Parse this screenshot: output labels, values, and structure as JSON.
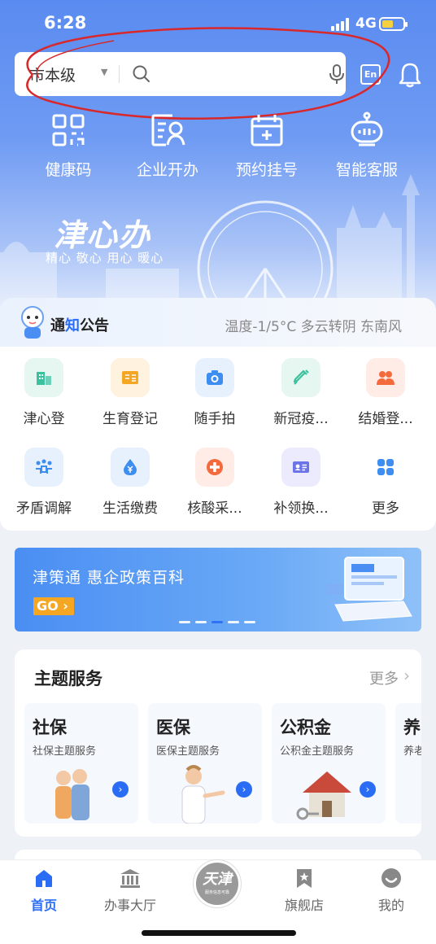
{
  "status_bar": {
    "time": "6:28",
    "network": "4G"
  },
  "search": {
    "region": "市本级",
    "placeholder": ""
  },
  "header_buttons": {
    "lang_label": "En"
  },
  "quick_actions": [
    {
      "label": "健康码",
      "icon": "qr-code-icon"
    },
    {
      "label": "企业开办",
      "icon": "business-card-icon"
    },
    {
      "label": "预约挂号",
      "icon": "medical-appointment-icon"
    },
    {
      "label": "智能客服",
      "icon": "robot-icon"
    }
  ],
  "brand": {
    "logo_text": "津心办",
    "slogan": "精心 敬心 用心 暖心"
  },
  "notice": {
    "title_a": "通",
    "title_b": "知",
    "title_c": "公告",
    "weather": "温度-1/5°C 多云转阴 东南风"
  },
  "services": [
    {
      "label": "津心登",
      "icon": "building-icon",
      "bg": "#e6f6f1",
      "fg": "#3ac19d"
    },
    {
      "label": "生育登记",
      "icon": "certificate-icon",
      "bg": "#fff2df",
      "fg": "#f5a623"
    },
    {
      "label": "随手拍",
      "icon": "camera-icon",
      "bg": "#e6f1fd",
      "fg": "#3d8ef0"
    },
    {
      "label": "新冠疫...",
      "icon": "syringe-icon",
      "bg": "#e6f6f1",
      "fg": "#3ac19d"
    },
    {
      "label": "结婚登...",
      "icon": "couple-icon",
      "bg": "#ffece6",
      "fg": "#f36b3c"
    },
    {
      "label": "矛盾调解",
      "icon": "mediation-icon",
      "bg": "#e6f1fd",
      "fg": "#3d8ef0"
    },
    {
      "label": "生活缴费",
      "icon": "payment-icon",
      "bg": "#e6f1fd",
      "fg": "#3d8ef0"
    },
    {
      "label": "核酸采...",
      "icon": "medical-cross-icon",
      "bg": "#ffece6",
      "fg": "#f36b3c"
    },
    {
      "label": "补领换...",
      "icon": "id-card-icon",
      "bg": "#ecebfd",
      "fg": "#6b74e8"
    },
    {
      "label": "更多",
      "icon": "more-grid-icon",
      "bg": "#ffffff",
      "fg": "#3d8ef0"
    }
  ],
  "banner": {
    "title": "津策通 惠企政策百科",
    "cta": "GO"
  },
  "themes": {
    "title": "主题服务",
    "more": "更多",
    "cards": [
      {
        "title": "社保",
        "subtitle": "社保主题服务"
      },
      {
        "title": "医保",
        "subtitle": "医保主题服务"
      },
      {
        "title": "公积金",
        "subtitle": "公积金主题服务"
      },
      {
        "title": "养",
        "subtitle": "养老主题服务"
      }
    ]
  },
  "tabbar": {
    "tabs": [
      {
        "label": "首页",
        "active": true
      },
      {
        "label": "办事大厅",
        "active": false
      },
      {
        "label": "旗舰店",
        "active": false
      },
      {
        "label": "我的",
        "active": false
      }
    ],
    "center_brand": "天津",
    "center_tag": "服务信息可靠"
  },
  "colors": {
    "primary": "#2a6df4",
    "accent": "#f5a623",
    "hero": "#5a8bf0"
  }
}
